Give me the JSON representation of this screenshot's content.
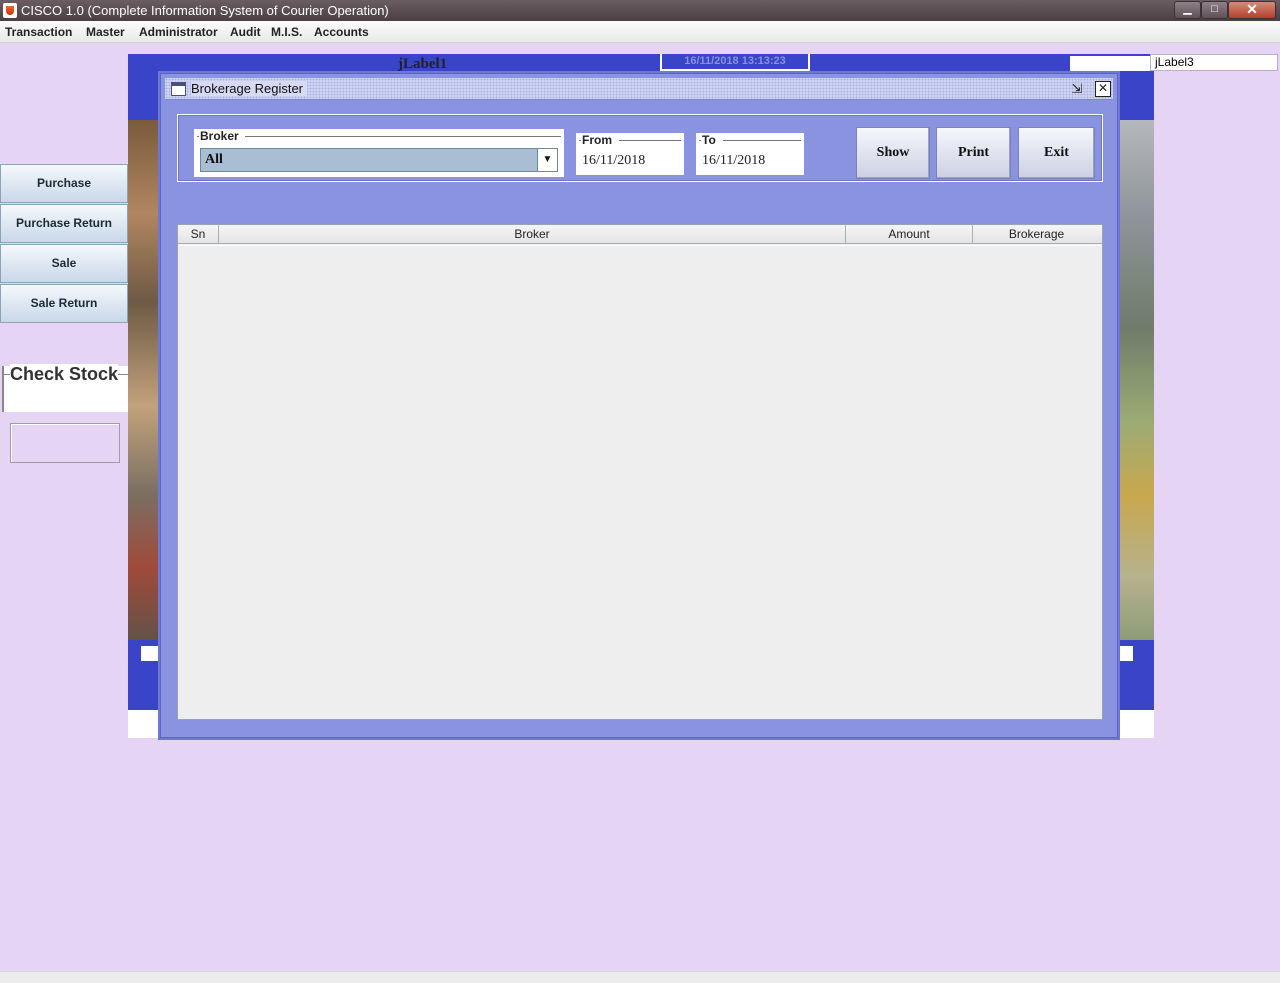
{
  "window": {
    "title": "CISCO 1.0 (Complete Information System of Courier Operation)",
    "controls": {
      "minimize": "▁",
      "maximize": "□",
      "close": "✕"
    }
  },
  "menubar": {
    "items": [
      "Transaction",
      "Master",
      "Administrator",
      "Audit",
      "M.I.S.",
      "Accounts"
    ]
  },
  "background": {
    "label1": "jLabel1",
    "datetime": "16/11/2018    13:13:23",
    "label3": "jLabel3"
  },
  "sidebar": {
    "buttons": [
      "Purchase",
      "Purchase Return",
      "Sale",
      "Sale Return"
    ],
    "check_stock_label": "Check Stock",
    "check_stock_value": ""
  },
  "dialog": {
    "title": "Brokerage Register",
    "restore_icon": "⇲",
    "close_icon": "✕",
    "broker": {
      "legend": "Broker",
      "selected": "All"
    },
    "from": {
      "legend": "From",
      "value": "16/11/2018"
    },
    "to": {
      "legend": "To",
      "value": "16/11/2018"
    },
    "buttons": {
      "show": "Show",
      "print": "Print",
      "exit": "Exit"
    },
    "table": {
      "columns": [
        "Sn",
        "Broker",
        "Amount",
        "Brokerage"
      ],
      "rows": []
    }
  },
  "icons": {
    "app": "java-cup-icon",
    "dropdown": "chevron-down-icon"
  }
}
